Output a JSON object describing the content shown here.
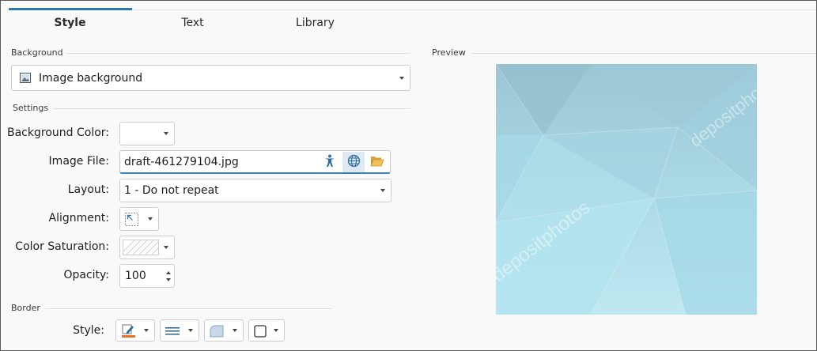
{
  "tabs": [
    {
      "label": "Style",
      "active": true
    },
    {
      "label": "Text",
      "active": false
    },
    {
      "label": "Library",
      "active": false
    }
  ],
  "background": {
    "group_label": "Background",
    "type_value": "Image background",
    "type_icon": "image-icon"
  },
  "settings": {
    "group_label": "Settings",
    "background_color_label": "Background Color:",
    "image_file_label": "Image File:",
    "image_file_value": "draft-461279104.jpg",
    "image_file_buttons": [
      "accessibility-icon",
      "web-globe-icon",
      "open-folder-icon"
    ],
    "layout_label": "Layout:",
    "layout_value": "1 - Do not repeat",
    "alignment_label": "Alignment:",
    "alignment_icon": "align-top-left-icon",
    "color_saturation_label": "Color Saturation:",
    "opacity_label": "Opacity:",
    "opacity_value": "100"
  },
  "border": {
    "group_label": "Border",
    "style_label": "Style:",
    "buttons": [
      "border-color-pen-icon",
      "line-style-icon",
      "corner-radius-icon",
      "border-box-icon"
    ]
  },
  "preview": {
    "group_label": "Preview",
    "watermark": "depositphotos"
  },
  "colors": {
    "accent": "#2b79a8",
    "input_underline": "#3b7fb3",
    "preview_top": "#9ec7d3",
    "preview_bottom": "#bfe8f2"
  }
}
